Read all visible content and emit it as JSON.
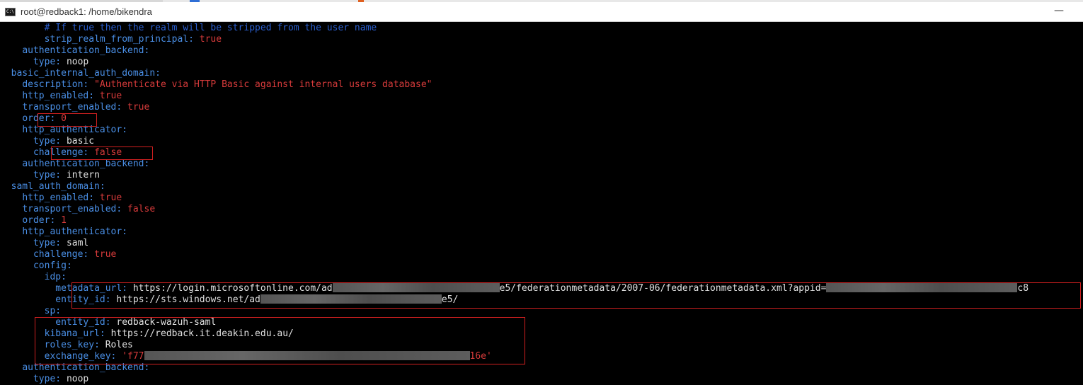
{
  "window": {
    "title": "root@redback1: /home/bikendra",
    "icon": "cmd-terminal-icon",
    "minimize_glyph": "—"
  },
  "colors": {
    "key": "#4a8fe6",
    "value": "#e0e0e0",
    "string": "#d83b3b",
    "comment": "#2a5fd0",
    "highlight_box": "#d02020"
  },
  "terminal": {
    "lines": [
      {
        "indent": "        ",
        "comment": "# If true then the realm will be stripped from the user name"
      },
      {
        "indent": "        ",
        "key": "strip_realm_from_principal",
        "sep": ":",
        "value": "true",
        "vtype": "str"
      },
      {
        "indent": "    ",
        "key": "authentication_backend",
        "sep": ":"
      },
      {
        "indent": "      ",
        "key": "type",
        "sep": ":",
        "value": "noop",
        "vtype": "v"
      },
      {
        "indent": "  ",
        "key": "basic_internal_auth_domain",
        "sep": ":"
      },
      {
        "indent": "    ",
        "key": "description",
        "sep": ":",
        "value": "\"Authenticate via HTTP Basic against internal users database\"",
        "vtype": "str"
      },
      {
        "indent": "    ",
        "key": "http_enabled",
        "sep": ":",
        "value": "true",
        "vtype": "str"
      },
      {
        "indent": "    ",
        "key": "transport_enabled",
        "sep": ":",
        "value": "true",
        "vtype": "str"
      },
      {
        "indent": "    ",
        "key": "order",
        "sep": ":",
        "value": "0",
        "vtype": "num"
      },
      {
        "indent": "    ",
        "key": "http_authenticator",
        "sep": ":"
      },
      {
        "indent": "      ",
        "key": "type",
        "sep": ":",
        "value": "basic",
        "vtype": "v"
      },
      {
        "indent": "      ",
        "key": "challenge",
        "sep": ":",
        "value": "false",
        "vtype": "str"
      },
      {
        "indent": "    ",
        "key": "authentication_backend",
        "sep": ":"
      },
      {
        "indent": "      ",
        "key": "type",
        "sep": ":",
        "value": "intern",
        "vtype": "v"
      },
      {
        "indent": "  ",
        "key": "saml_auth_domain",
        "sep": ":"
      },
      {
        "indent": "    ",
        "key": "http_enabled",
        "sep": ":",
        "value": "true",
        "vtype": "str"
      },
      {
        "indent": "    ",
        "key": "transport_enabled",
        "sep": ":",
        "value": "false",
        "vtype": "str"
      },
      {
        "indent": "    ",
        "key": "order",
        "sep": ":",
        "value": "1",
        "vtype": "num"
      },
      {
        "indent": "    ",
        "key": "http_authenticator",
        "sep": ":"
      },
      {
        "indent": "      ",
        "key": "type",
        "sep": ":",
        "value": "saml",
        "vtype": "v"
      },
      {
        "indent": "      ",
        "key": "challenge",
        "sep": ":",
        "value": "true",
        "vtype": "str"
      },
      {
        "indent": "      ",
        "key": "config",
        "sep": ":"
      },
      {
        "indent": "        ",
        "key": "idp",
        "sep": ":"
      },
      {
        "indent": "          ",
        "key": "metadata_url",
        "sep": ":",
        "value": "https://login.microsoftonline.com/ad",
        "vtype": "v",
        "redact": 236,
        "after": "e5/federationmetadata/2007-06/federationmetadata.xml?appid=",
        "redact2": 270,
        "after2": "c8"
      },
      {
        "indent": "          ",
        "key": "entity_id",
        "sep": ":",
        "value": "https://sts.windows.net/ad",
        "vtype": "v",
        "redact": 256,
        "after": "e5/"
      },
      {
        "indent": "        ",
        "key": "sp",
        "sep": ":"
      },
      {
        "indent": "          ",
        "key": "entity_id",
        "sep": ":",
        "value": "redback-wazuh-saml",
        "vtype": "v"
      },
      {
        "indent": "        ",
        "key": "kibana_url",
        "sep": ":",
        "value": "https://redback.it.deakin.edu.au/",
        "vtype": "v"
      },
      {
        "indent": "        ",
        "key": "roles_key",
        "sep": ":",
        "value": "Roles",
        "vtype": "v"
      },
      {
        "indent": "        ",
        "key": "exchange_key",
        "sep": ":",
        "value": "'f77",
        "vtype": "str",
        "redact": 460,
        "after": "16e'",
        "after_type": "str"
      },
      {
        "indent": "    ",
        "key": "authentication_backend",
        "sep": ":"
      },
      {
        "indent": "      ",
        "key": "type",
        "sep": ":",
        "value": "noop",
        "vtype": "v"
      }
    ]
  }
}
